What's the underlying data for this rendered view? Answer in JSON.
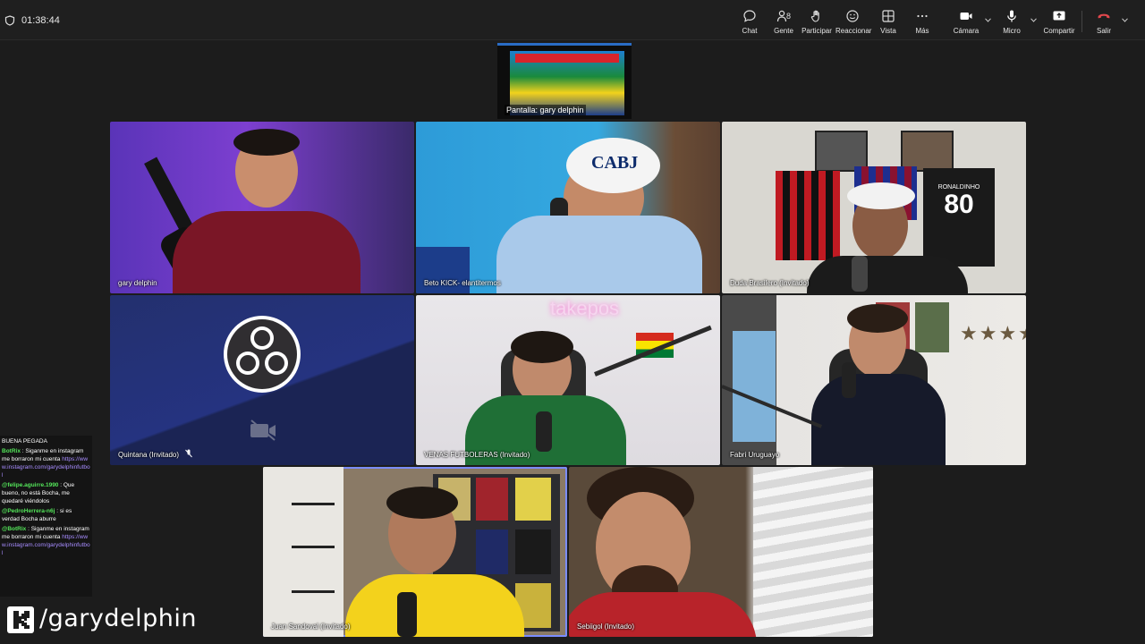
{
  "meeting": {
    "timer": "01:38:44"
  },
  "toolbar": {
    "chat": "Chat",
    "people": "Gente",
    "people_count": "8",
    "raise": "Participar",
    "react": "Reaccionar",
    "view": "Vista",
    "more": "Más",
    "camera": "Cámara",
    "mic": "Micro",
    "share": "Compartir",
    "leave": "Salir"
  },
  "screen_share": {
    "label": "Pantalla: gary delphin"
  },
  "participants": [
    {
      "name": "gary delphin"
    },
    {
      "name": "Beto KICK- elantitermos"
    },
    {
      "name": "Duda Brasilero (Invitado)"
    },
    {
      "name": "Quintana (Invitado)"
    },
    {
      "name": "VENAS FUTBOLERAS (Invitado)"
    },
    {
      "name": "Fabri Uruguayo"
    },
    {
      "name": "Juan Sandoval (Invitado)"
    },
    {
      "name": "Sebiigol (Invitado)"
    }
  ],
  "overlay": {
    "cap_text": "CABJ",
    "jersey_name": "RONALDINHO",
    "jersey_number": "80",
    "neon_sign": "takepos"
  },
  "chat": {
    "messages": [
      {
        "user": "",
        "text": "BUENA PEGADA"
      },
      {
        "user": "BotRix",
        "text": ": Siganme en instagram me borraron mi cuenta",
        "link": "https://www.instagram.com/garydelphinfutbol"
      },
      {
        "user": "@felipe.aguirre.1990",
        "text": ": Que bueno, no está Bocha, me quedaré viéndolos"
      },
      {
        "user": "@PedroHerrera-n6j",
        "text": ": si es verdad Bocha aburre"
      },
      {
        "user": "@BotRix",
        "text": ": Siganme en instagram me borraron mi cuenta",
        "link": "https://www.instagram.com/garydelphinfutbol"
      }
    ]
  },
  "branding": {
    "handle": "/garydelphin"
  },
  "colors": {
    "accent": "#2a6cc5",
    "leave": "#e0474c",
    "chat_user": "#54e65a",
    "chat_link": "#a78cff"
  }
}
